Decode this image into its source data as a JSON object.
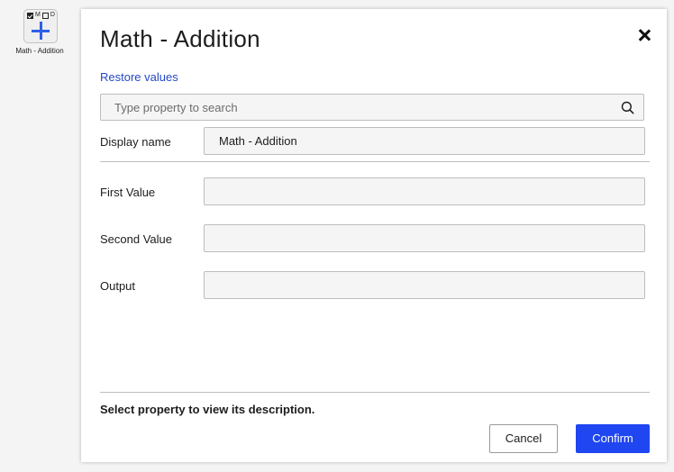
{
  "node": {
    "flag_m": "M",
    "flag_d": "D",
    "label": "Math - Addition",
    "icon": "plus-icon",
    "accent_color": "#2f5fe8"
  },
  "dialog": {
    "title": "Math - Addition",
    "restore_label": "Restore values",
    "search_placeholder": "Type property to search",
    "fields": {
      "display_name": {
        "label": "Display name",
        "value": "Math - Addition"
      },
      "first_value": {
        "label": "First Value",
        "value": ""
      },
      "second_value": {
        "label": "Second Value",
        "value": ""
      },
      "output": {
        "label": "Output",
        "value": ""
      }
    },
    "description": "Select property to view its description.",
    "cancel_label": "Cancel",
    "confirm_label": "Confirm",
    "link_color": "#2448c8",
    "confirm_color": "#1f46f0"
  }
}
